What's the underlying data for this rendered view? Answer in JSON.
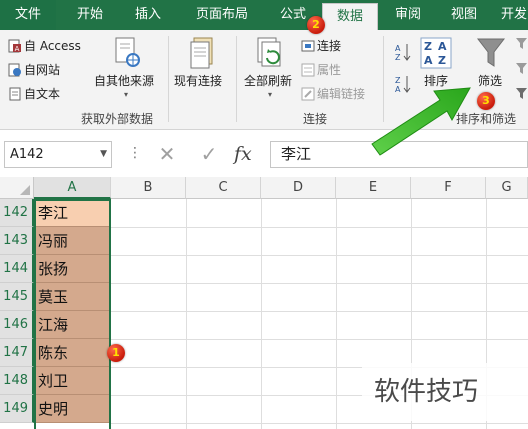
{
  "tabs": [
    "文件",
    "开始",
    "插入",
    "页面布局",
    "公式",
    "数据",
    "审阅",
    "视图",
    "开发"
  ],
  "ribbon": {
    "get_external": {
      "access": "自 Access",
      "web": "自网站",
      "text": "自文本",
      "other_sources": "自其他来源",
      "group_label": "获取外部数据"
    },
    "existing_connections": "现有连接",
    "connections": {
      "refresh_all": "全部刷新",
      "connections": "连接",
      "properties": "属性",
      "edit_links": "编辑链接",
      "group_label": "连接"
    },
    "sort_filter": {
      "sort": "排序",
      "filter": "筛选",
      "group_label": "排序和筛选"
    }
  },
  "badges": {
    "one": "1",
    "two": "2",
    "three": "3"
  },
  "formula_bar": {
    "name_box": "A142",
    "cancel": "✕",
    "enter": "✓",
    "fx": "fx",
    "content": "李江"
  },
  "columns": [
    "A",
    "B",
    "C",
    "D",
    "E",
    "F",
    "G"
  ],
  "rows": [
    {
      "num": "142",
      "a": "李江"
    },
    {
      "num": "143",
      "a": "冯丽"
    },
    {
      "num": "144",
      "a": "张扬"
    },
    {
      "num": "145",
      "a": "莫玉"
    },
    {
      "num": "146",
      "a": "江海"
    },
    {
      "num": "147",
      "a": "陈东"
    },
    {
      "num": "148",
      "a": "刘卫"
    },
    {
      "num": "149",
      "a": "史明"
    }
  ],
  "watermark": "软件技巧",
  "colors": {
    "excel_green": "#217346",
    "selected_cell": "#d4a98d",
    "active_cell": "#f8cfb0",
    "badge": "#d0200f",
    "arrow": "#3dbd2a"
  }
}
